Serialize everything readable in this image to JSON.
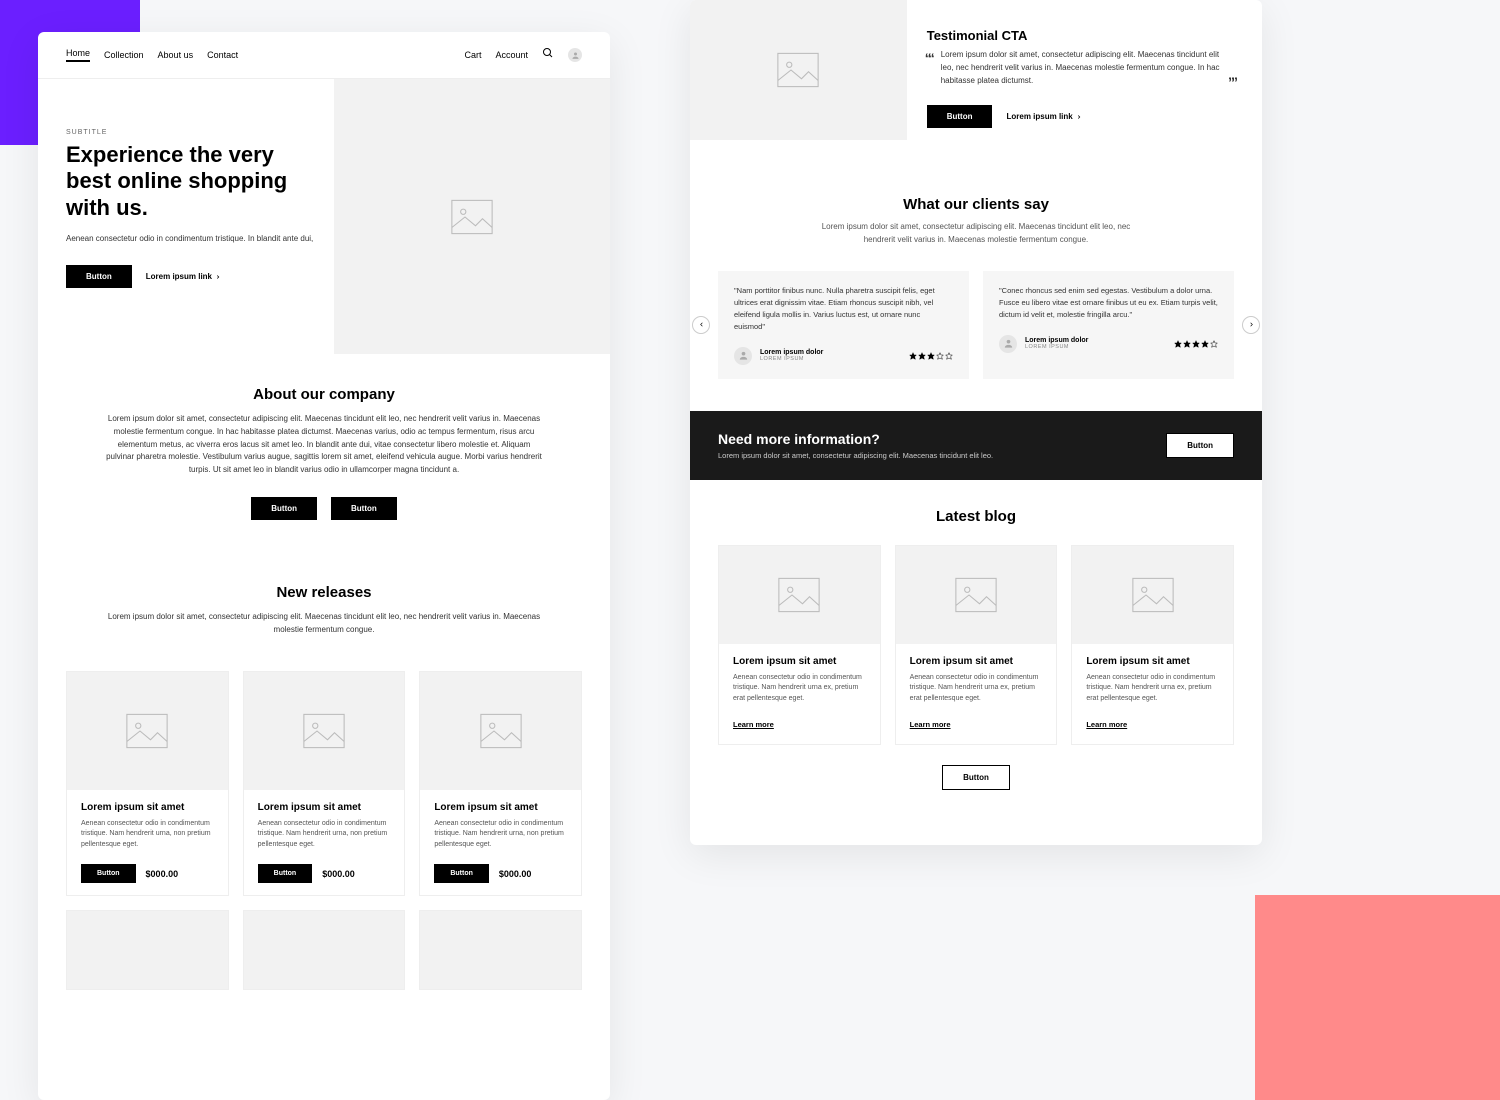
{
  "nav": {
    "items": [
      "Home",
      "Collection",
      "About us",
      "Contact"
    ],
    "cart": "Cart",
    "account": "Account"
  },
  "hero": {
    "subtitle": "SUBTITLE",
    "title": "Experience the very best online shopping with us.",
    "body": "Aenean consectetur odio in condimentum tristique. In blandit ante dui,",
    "button": "Button",
    "link": "Lorem ipsum link"
  },
  "about": {
    "title": "About our company",
    "body": "Lorem ipsum dolor sit amet, consectetur adipiscing elit. Maecenas tincidunt elit leo, nec hendrerit velit varius in. Maecenas molestie fermentum congue. In hac habitasse platea dictumst. Maecenas varius, odio ac tempus fermentum, risus arcu elementum metus, ac viverra eros lacus sit amet leo. In blandit ante dui, vitae consectetur libero molestie et. Aliquam pulvinar pharetra molestie. Vestibulum varius augue, sagittis lorem sit amet, eleifend vehicula augue. Morbi varius hendrerit turpis. Ut sit amet leo in blandit varius odio in ullamcorper magna tincidunt a.",
    "button1": "Button",
    "button2": "Button"
  },
  "releases": {
    "title": "New releases",
    "body": "Lorem ipsum dolor sit amet, consectetur adipiscing elit. Maecenas tincidunt elit leo, nec hendrerit velit varius in. Maecenas molestie fermentum congue.",
    "items": [
      {
        "title": "Lorem ipsum sit amet",
        "body": "Aenean consectetur odio in condimentum tristique. Nam hendrerit urna, non pretium pellentesque eget.",
        "button": "Button",
        "price": "$000.00"
      },
      {
        "title": "Lorem ipsum sit amet",
        "body": "Aenean consectetur odio in condimentum tristique. Nam hendrerit urna, non pretium pellentesque eget.",
        "button": "Button",
        "price": "$000.00"
      },
      {
        "title": "Lorem ipsum sit amet",
        "body": "Aenean consectetur odio in condimentum tristique. Nam hendrerit urna, non pretium pellentesque eget.",
        "button": "Button",
        "price": "$000.00"
      }
    ]
  },
  "tcta": {
    "title": "Testimonial CTA",
    "body": "Lorem ipsum dolor sit amet, consectetur adipiscing elit. Maecenas tincidunt elit leo, nec hendrerit velit varius in. Maecenas molestie fermentum congue. In hac habitasse platea dictumst.",
    "button": "Button",
    "link": "Lorem ipsum link"
  },
  "clients": {
    "title": "What our clients say",
    "body": "Lorem ipsum dolor sit amet, consectetur adipiscing elit. Maecenas tincidunt elit leo, nec hendrerit velit varius in. Maecenas molestie fermentum congue.",
    "items": [
      {
        "quote": "\"Nam porttitor finibus nunc. Nulla pharetra suscipit felis, eget ultrices erat dignissim vitae. Etiam rhoncus suscipit nibh, vel eleifend ligula mollis in. Varius luctus est, ut ornare nunc euismod\"",
        "name": "Lorem ipsum dolor",
        "sub": "LOREM IPSUM",
        "rating": 3
      },
      {
        "quote": "\"Conec rhoncus sed enim sed egestas. Vestibulum a dolor urna. Fusce eu libero vitae est ornare finibus ut eu ex. Etiam turpis velit, dictum id velit et, molestie fringilla arcu.\"",
        "name": "Lorem ipsum dolor",
        "sub": "LOREM IPSUM",
        "rating": 4
      }
    ]
  },
  "infocta": {
    "title": "Need more information?",
    "body": "Lorem ipsum dolor sit amet, consectetur adipiscing elit. Maecenas tincidunt elit leo.",
    "button": "Button"
  },
  "blog": {
    "title": "Latest blog",
    "items": [
      {
        "title": "Lorem ipsum sit amet",
        "body": "Aenean consectetur odio in condimentum tristique. Nam hendrerit urna ex, pretium erat pellentesque eget.",
        "link": "Learn more"
      },
      {
        "title": "Lorem ipsum sit amet",
        "body": "Aenean consectetur odio in condimentum tristique. Nam hendrerit urna ex, pretium erat pellentesque eget.",
        "link": "Learn more"
      },
      {
        "title": "Lorem ipsum sit amet",
        "body": "Aenean consectetur odio in condimentum tristique. Nam hendrerit urna ex, pretium erat pellentesque eget.",
        "link": "Learn more"
      }
    ],
    "button": "Button"
  }
}
